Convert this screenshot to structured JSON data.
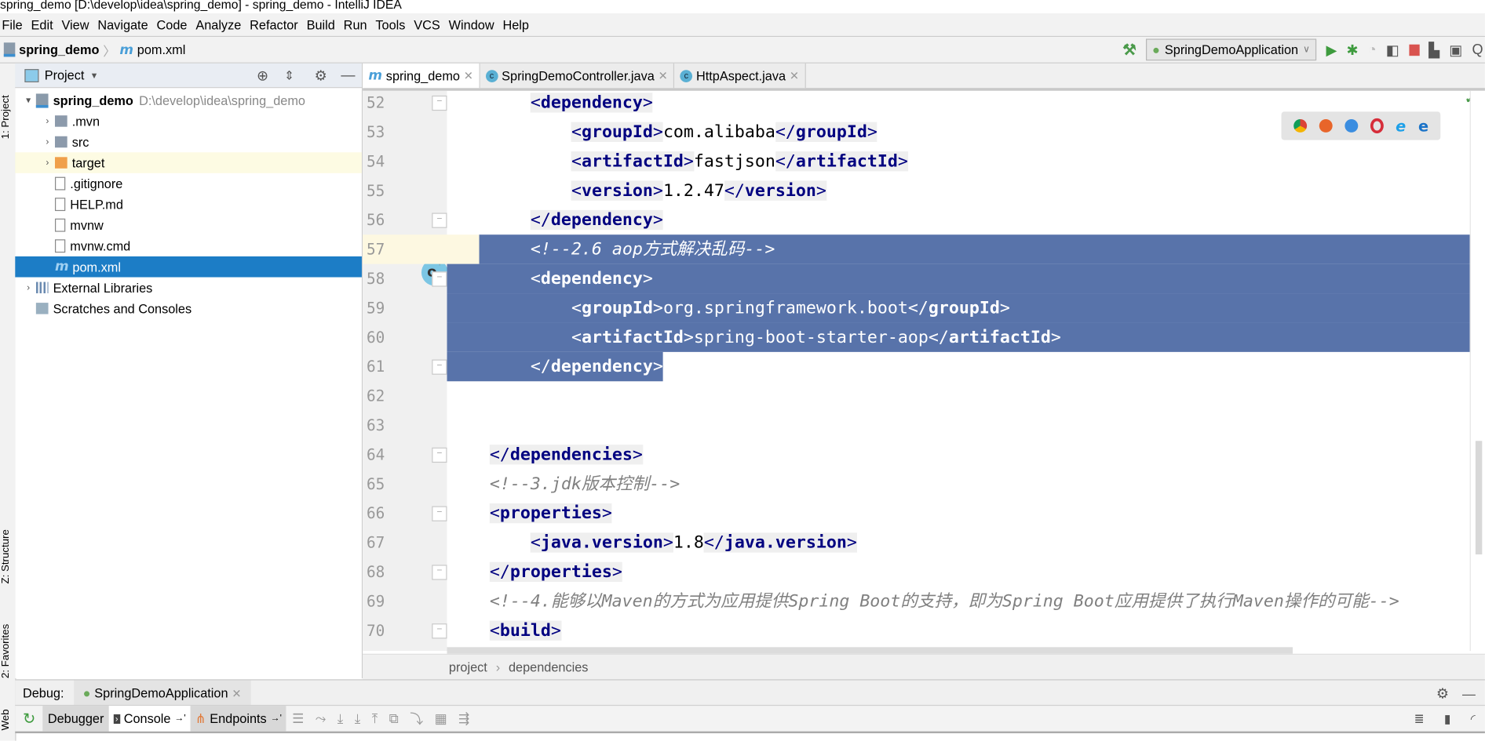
{
  "window": {
    "title": "spring_demo [D:\\develop\\idea\\spring_demo] - spring_demo - IntelliJ IDEA"
  },
  "menu": [
    "File",
    "Edit",
    "View",
    "Navigate",
    "Code",
    "Analyze",
    "Refactor",
    "Build",
    "Run",
    "Tools",
    "VCS",
    "Window",
    "Help"
  ],
  "nav": {
    "project": "spring_demo",
    "file": "pom.xml",
    "run_config": "SpringDemoApplication"
  },
  "left_strip": {
    "project": "1: Project",
    "structure": "Z: Structure",
    "favorites": "2: Favorites",
    "web": "Web"
  },
  "project_panel": {
    "title": "Project",
    "items": [
      {
        "label": "spring_demo",
        "extra": "D:\\develop\\idea\\spring_demo",
        "level": 0,
        "arrow": "▾",
        "icon": "folder-module",
        "bold": true
      },
      {
        "label": ".mvn",
        "level": 1,
        "arrow": "›",
        "icon": "folder"
      },
      {
        "label": "src",
        "level": 1,
        "arrow": "›",
        "icon": "folder"
      },
      {
        "label": "target",
        "level": 1,
        "arrow": "›",
        "icon": "folder-orange",
        "highlight": true
      },
      {
        "label": ".gitignore",
        "level": 1,
        "icon": "file"
      },
      {
        "label": "HELP.md",
        "level": 1,
        "icon": "md-file"
      },
      {
        "label": "mvnw",
        "level": 1,
        "icon": "file"
      },
      {
        "label": "mvnw.cmd",
        "level": 1,
        "icon": "file"
      },
      {
        "label": "pom.xml",
        "level": 1,
        "icon": "maven-file",
        "selected": true
      },
      {
        "label": "External Libraries",
        "level": 0,
        "arrow": "›",
        "icon": "libraries"
      },
      {
        "label": "Scratches and Consoles",
        "level": 0,
        "icon": "scratches"
      }
    ]
  },
  "tabs": [
    {
      "label": "spring_demo",
      "icon": "maven",
      "active": true
    },
    {
      "label": "SpringDemoController.java",
      "icon": "class"
    },
    {
      "label": "HttpAspect.java",
      "icon": "class"
    }
  ],
  "editor": {
    "lines": [
      {
        "n": "52",
        "indent": 2,
        "parts": [
          [
            "t",
            "<dependency>"
          ]
        ]
      },
      {
        "n": "53",
        "indent": 3,
        "parts": [
          [
            "t",
            "<groupId>"
          ],
          [
            "x",
            "com.alibaba"
          ],
          [
            "t",
            "</groupId>"
          ]
        ]
      },
      {
        "n": "54",
        "indent": 3,
        "parts": [
          [
            "t",
            "<artifactId>"
          ],
          [
            "x",
            "fastjson"
          ],
          [
            "t",
            "</artifactId>"
          ]
        ]
      },
      {
        "n": "55",
        "indent": 3,
        "parts": [
          [
            "t",
            "<version>"
          ],
          [
            "x",
            "1.2.47"
          ],
          [
            "t",
            "</version>"
          ]
        ]
      },
      {
        "n": "56",
        "indent": 2,
        "parts": [
          [
            "t",
            "</dependency>"
          ]
        ]
      },
      {
        "n": "57",
        "indent": 2,
        "parts": [
          [
            "c",
            "<!--2.6 aop方式解决乱码-->"
          ]
        ],
        "selected": true,
        "current": true
      },
      {
        "n": "58",
        "indent": 2,
        "parts": [
          [
            "t",
            "<dependency>"
          ]
        ],
        "selected": true
      },
      {
        "n": "59",
        "indent": 3,
        "parts": [
          [
            "t",
            "<groupId>"
          ],
          [
            "x",
            "org.springframework.boot"
          ],
          [
            "t",
            "</groupId>"
          ]
        ],
        "selected": true
      },
      {
        "n": "60",
        "indent": 3,
        "parts": [
          [
            "t",
            "<artifactId>"
          ],
          [
            "x",
            "spring-boot-starter-aop"
          ],
          [
            "t",
            "</artifactId>"
          ]
        ],
        "selected": true
      },
      {
        "n": "61",
        "indent": 2,
        "parts": [
          [
            "t",
            "</dependency>"
          ]
        ],
        "selected": true,
        "selection_end": true
      },
      {
        "n": "62",
        "indent": 0,
        "parts": []
      },
      {
        "n": "63",
        "indent": 0,
        "parts": []
      },
      {
        "n": "64",
        "indent": 1,
        "parts": [
          [
            "t",
            "</dependencies>"
          ]
        ]
      },
      {
        "n": "65",
        "indent": 1,
        "parts": [
          [
            "c",
            "<!--3.jdk版本控制-->"
          ]
        ]
      },
      {
        "n": "66",
        "indent": 1,
        "parts": [
          [
            "t",
            "<properties>"
          ]
        ]
      },
      {
        "n": "67",
        "indent": 2,
        "parts": [
          [
            "t",
            "<java.version>"
          ],
          [
            "x",
            "1.8"
          ],
          [
            "t",
            "</java.version>"
          ]
        ]
      },
      {
        "n": "68",
        "indent": 1,
        "parts": [
          [
            "t",
            "</properties>"
          ]
        ]
      },
      {
        "n": "69",
        "indent": 1,
        "parts": [
          [
            "c",
            "<!--4.能够以Maven的方式为应用提供Spring Boot的支持，即为Spring Boot应用提供了执行Maven操作的可能-->"
          ]
        ]
      },
      {
        "n": "70",
        "indent": 1,
        "parts": [
          [
            "t",
            "<build>"
          ]
        ]
      }
    ],
    "fold_lines": [
      "52",
      "56",
      "58",
      "61",
      "64",
      "66",
      "68",
      "70"
    ],
    "colors": {
      "selection": "#5873aa",
      "tag": "#000080",
      "comment": "#808080",
      "current_line": "#fdf8e1"
    }
  },
  "breadcrumb": [
    "project",
    "dependencies"
  ],
  "debug": {
    "label": "Debug:",
    "session": "SpringDemoApplication",
    "tabs": [
      "Debugger",
      "Console",
      "Endpoints"
    ]
  }
}
